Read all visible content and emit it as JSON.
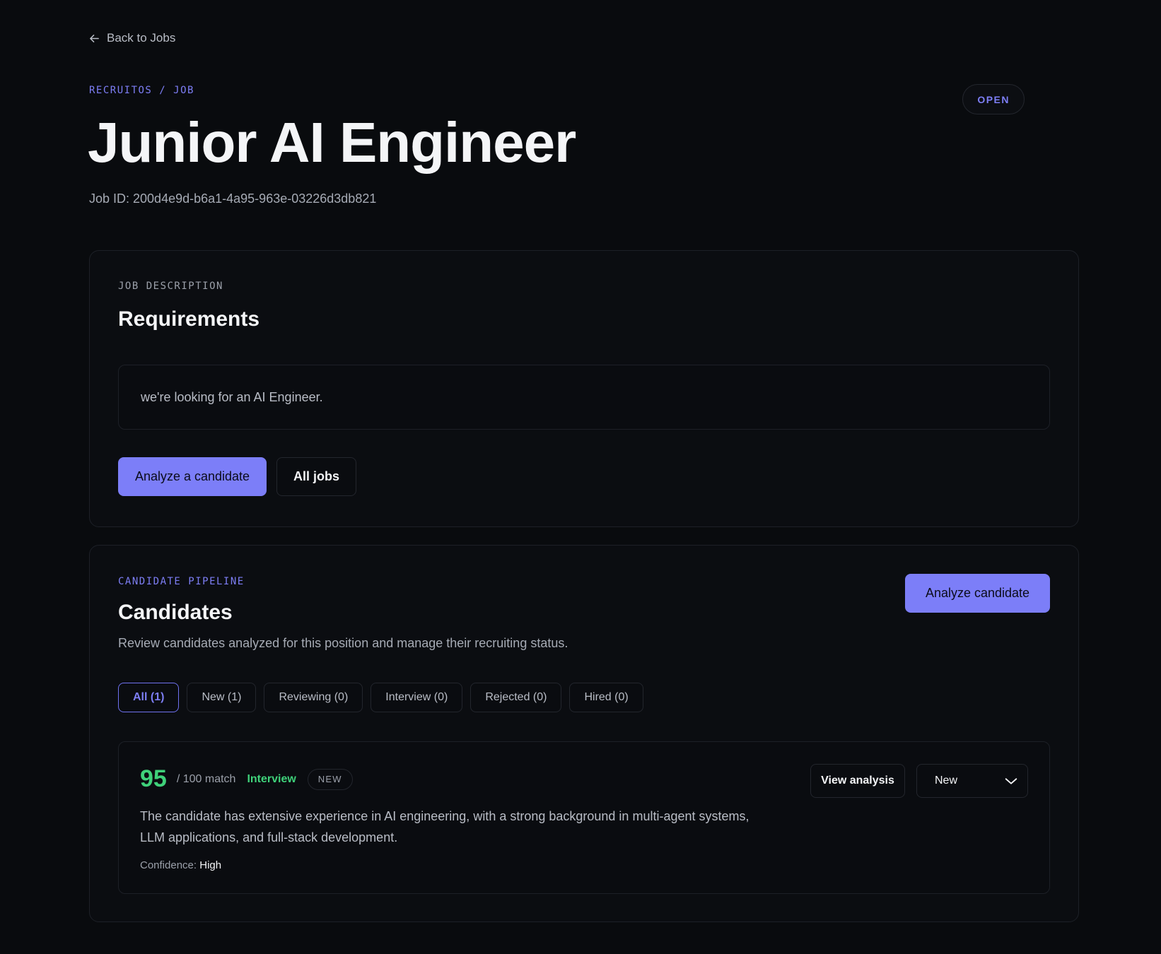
{
  "nav": {
    "back_label": "Back to Jobs"
  },
  "header": {
    "breadcrumb": "RECRUITOS / JOB",
    "status": "OPEN",
    "title": "Junior AI Engineer",
    "job_id": "Job ID: 200d4e9d-b6a1-4a95-963e-03226d3db821"
  },
  "description": {
    "eyebrow": "JOB DESCRIPTION",
    "title": "Requirements",
    "text": "we're looking for an AI Engineer.",
    "analyze_button": "Analyze a candidate",
    "all_jobs_button": "All jobs"
  },
  "pipeline": {
    "eyebrow": "CANDIDATE PIPELINE",
    "title": "Candidates",
    "subtitle": "Review candidates analyzed for this position and manage their recruiting status.",
    "analyze_button": "Analyze candidate",
    "tabs": [
      {
        "label": "All (1)",
        "active": true
      },
      {
        "label": "New (1)"
      },
      {
        "label": "Reviewing (0)"
      },
      {
        "label": "Interview (0)"
      },
      {
        "label": "Rejected (0)"
      },
      {
        "label": "Hired (0)"
      }
    ],
    "candidates": [
      {
        "score": "95",
        "score_suffix": "/ 100 match",
        "stage": "Interview",
        "badge": "NEW",
        "summary": "The candidate has extensive experience in AI engineering, with a strong background in multi-agent systems, LLM applications, and full-stack development.",
        "confidence_label": "Confidence:",
        "confidence_value": "High",
        "view_button": "View analysis",
        "status_value": "New"
      }
    ]
  },
  "colors": {
    "accent": "#7c7ef8",
    "success": "#3fd17a",
    "background": "#090b0e"
  },
  "icons": {
    "back": "arrow-left-icon",
    "dropdown": "chevron-down-icon"
  }
}
